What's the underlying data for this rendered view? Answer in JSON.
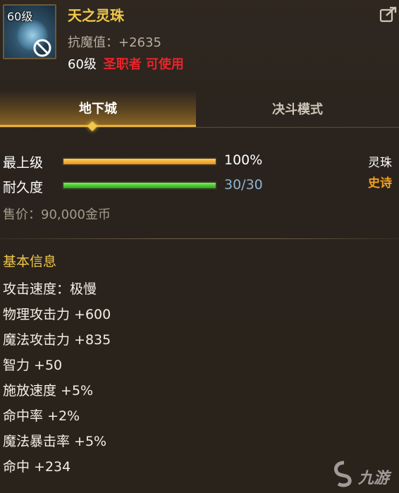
{
  "item": {
    "icon_level": "60级",
    "name": "天之灵珠",
    "resist_line": "抗魔值：+2635",
    "req_level": "60级",
    "req_class": "圣职者 可使用"
  },
  "tabs": [
    {
      "label": "地下城",
      "active": true
    },
    {
      "label": "决斗模式",
      "active": false
    }
  ],
  "stats": {
    "upgrade_label": "最上级",
    "upgrade_value": "100%",
    "upgrade_fraction": 1.0,
    "durability_label": "耐久度",
    "durability_value": "30/30",
    "durability_fraction": 1.0
  },
  "side": {
    "type": "灵珠",
    "rarity": "史诗"
  },
  "price": "售价：90,000金币",
  "basic_info_title": "基本信息",
  "attributes": [
    "攻击速度：极慢",
    "物理攻击力 +600",
    "魔法攻击力 +835",
    "智力 +50",
    "施放速度 +5%",
    "命中率 +2%",
    "魔法暴击率 +5%",
    "命中 +234"
  ],
  "watermark": "九游",
  "colors": {
    "title_gold": "#f0c84a",
    "class_red": "#e8242a",
    "rarity_orange": "#f0a020",
    "durability_text": "#8fb4d0",
    "upgrade_text": "#ffffff"
  }
}
